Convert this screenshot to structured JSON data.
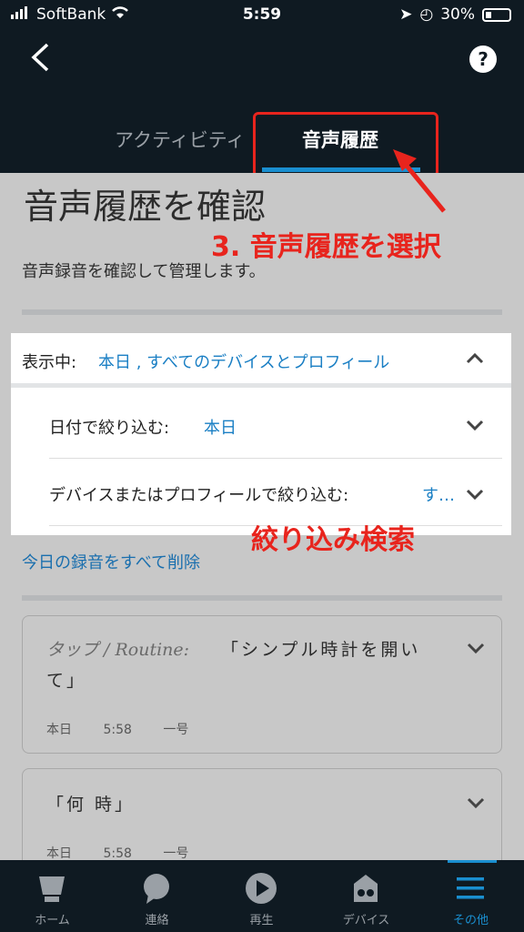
{
  "status_bar": {
    "carrier": "SoftBank",
    "time": "5:59",
    "battery": "30%"
  },
  "header": {
    "back_icon": "chevron-left-icon",
    "help_icon": "?"
  },
  "tabs": [
    {
      "label": "アクティビティ",
      "active": false
    },
    {
      "label": "音声履歴",
      "active": true
    }
  ],
  "page": {
    "title": "音声履歴を確認",
    "subtitle": "音声録音を確認して管理します。"
  },
  "annotations": {
    "select_tab": "3. 音声履歴を選択",
    "filter_search": "絞り込み検索"
  },
  "filter": {
    "display_label": "表示中:",
    "display_value": "本日 , すべてのデバイスとプロフィール",
    "date_label": "日付で絞り込む:",
    "date_value": "本日",
    "device_label": "デバイスまたはプロフィールで絞り込む:",
    "device_value": "す…"
  },
  "delete_link": "今日の録音をすべて削除",
  "recordings": [
    {
      "source": "タップ / Routine:",
      "quote_line1": "「シンプル時計を開い",
      "quote_line2": "て」",
      "date": "本日",
      "time": "5:58",
      "device": "一号"
    },
    {
      "source": "",
      "quote_line1": "「何 時」",
      "quote_line2": "",
      "date": "本日",
      "time": "5:58",
      "device": "一号"
    }
  ],
  "bottom_nav": [
    {
      "label": "ホーム",
      "icon": "home-icon",
      "active": false
    },
    {
      "label": "連絡",
      "icon": "chat-bubble-icon",
      "active": false
    },
    {
      "label": "再生",
      "icon": "play-icon",
      "active": false
    },
    {
      "label": "デバイス",
      "icon": "devices-icon",
      "active": false
    },
    {
      "label": "その他",
      "icon": "menu-icon",
      "active": true
    }
  ],
  "colors": {
    "accent": "#1a8fd0",
    "annotation_red": "#e8241d",
    "header_bg": "#0f1a22"
  }
}
